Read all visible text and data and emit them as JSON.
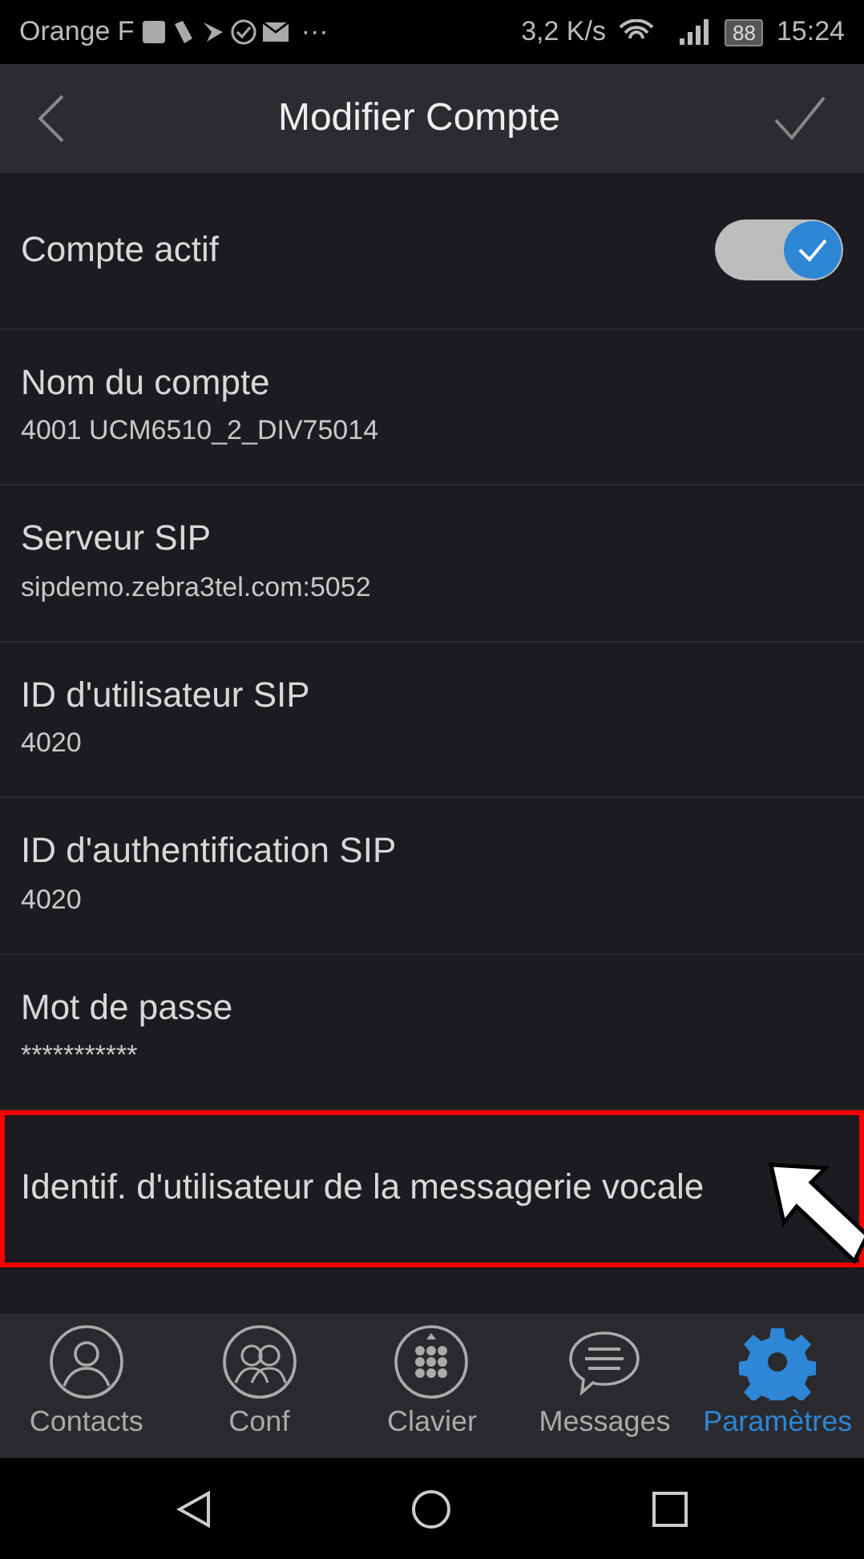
{
  "status_bar": {
    "carrier": "Orange F",
    "more": "···",
    "speed": "3,2 K/s",
    "battery": "88",
    "time": "15:24"
  },
  "header": {
    "title": "Modifier Compte"
  },
  "settings": [
    {
      "kind": "toggle",
      "label": "Compte actif",
      "on": true,
      "highlighted": false
    },
    {
      "kind": "field",
      "label": "Nom du compte",
      "value": "4001 UCM6510_2_DIV75014",
      "highlighted": false
    },
    {
      "kind": "field",
      "label": "Serveur SIP",
      "value": "sipdemo.zebra3tel.com:5052",
      "highlighted": false
    },
    {
      "kind": "field",
      "label": "ID d'utilisateur SIP",
      "value": "4020",
      "highlighted": false
    },
    {
      "kind": "field",
      "label": "ID d'authentification SIP",
      "value": "4020",
      "highlighted": false
    },
    {
      "kind": "field",
      "label": "Mot de passe",
      "value": "***********",
      "highlighted": false
    },
    {
      "kind": "field",
      "label": "Identif. d'utilisateur de la messagerie vocale",
      "highlighted": true
    }
  ],
  "tabs": [
    {
      "kind": "contacts",
      "label": "Contacts",
      "selected": false
    },
    {
      "kind": "conf",
      "label": "Conf",
      "selected": false
    },
    {
      "kind": "keypad",
      "label": "Clavier",
      "selected": false
    },
    {
      "kind": "messages",
      "label": "Messages",
      "selected": false
    },
    {
      "kind": "settings",
      "label": "Paramètres",
      "selected": true
    }
  ]
}
